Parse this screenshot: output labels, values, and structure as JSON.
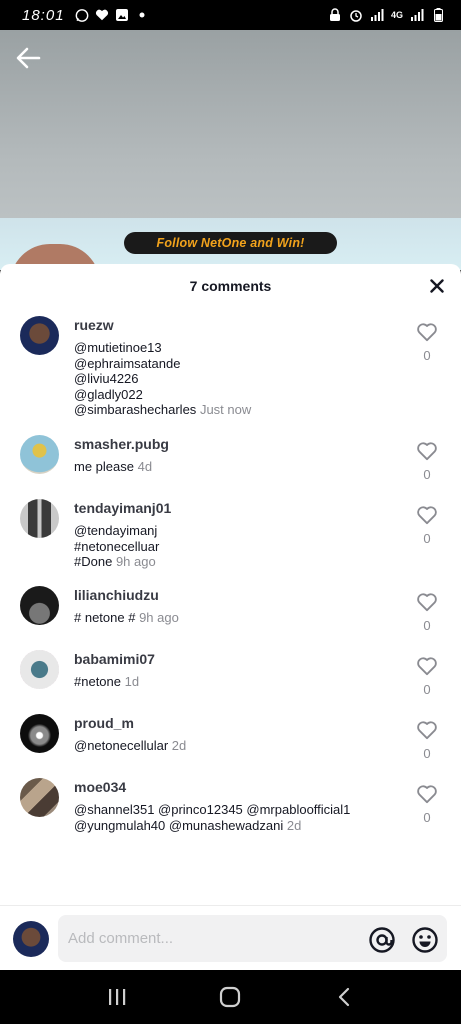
{
  "status_bar": {
    "time": "18:01",
    "network": "4G"
  },
  "video": {
    "banner_text": "Follow NetOne and Win!"
  },
  "comments_sheet": {
    "title": "7 comments",
    "comments": [
      {
        "user": "ruezw",
        "text": "@mutietinoe13\n@ephraimsatande\n@liviu4226\n@gladly022\n@simbarashecharles",
        "time": "Just now",
        "likes": "0"
      },
      {
        "user": "smasher.pubg",
        "text": "me please",
        "time": "4d",
        "likes": "0"
      },
      {
        "user": "tendayimanj01",
        "text": "@tendayimanj\n#netonecelluar\n#Done",
        "time": "9h ago",
        "likes": "0"
      },
      {
        "user": "lilianchiudzu",
        "text": "# netone #",
        "time": "9h ago",
        "likes": "0"
      },
      {
        "user": "babamimi07",
        "text": "#netone",
        "time": "1d",
        "likes": "0"
      },
      {
        "user": "proud_m",
        "text": "@netonecellular",
        "time": "2d",
        "likes": "0"
      },
      {
        "user": "moe034",
        "text": "@shannel351 @princo12345 @mrpabloofficial1\n@yungmulah40 @munashewadzani",
        "time": "2d",
        "likes": "0"
      }
    ]
  },
  "input": {
    "placeholder": "Add comment..."
  },
  "colors": {
    "text_primary": "#161823",
    "text_secondary": "#8a8b91",
    "banner_text": "#f2a31c"
  },
  "icons": [
    "back-arrow-icon",
    "close-icon",
    "heart-icon",
    "at-icon",
    "emoji-icon",
    "recent-apps-icon",
    "home-icon",
    "nav-back-icon"
  ]
}
